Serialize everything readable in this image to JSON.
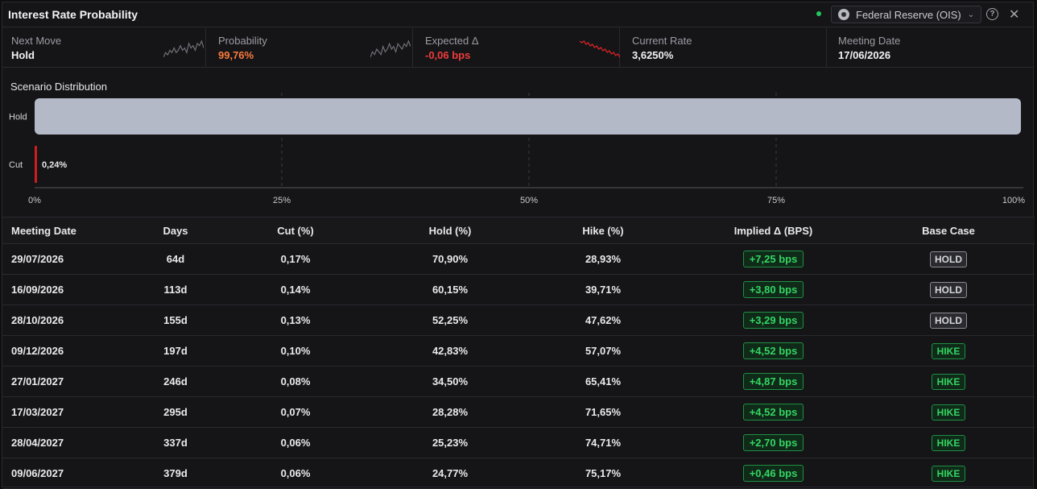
{
  "header": {
    "title": "Interest Rate Probability",
    "source": "Federal Reserve (OIS)",
    "help": "?",
    "close": "✕"
  },
  "stats": [
    {
      "label": "Next Move",
      "value": "Hold",
      "tone": "white",
      "spark": "gray",
      "spark_values": [
        3,
        5,
        4,
        6,
        5,
        7,
        5,
        6,
        8,
        6,
        7,
        5,
        9,
        7,
        8,
        6,
        9,
        8,
        10,
        7
      ]
    },
    {
      "label": "Probability",
      "value": "99,76%",
      "tone": "orange",
      "spark": "gray",
      "spark_values": [
        4,
        6,
        5,
        7,
        6,
        5,
        8,
        6,
        7,
        9,
        7,
        8,
        6,
        9,
        8,
        7,
        9,
        8,
        10,
        8
      ]
    },
    {
      "label": "Expected Δ",
      "value": "-0,06 bps",
      "tone": "red",
      "spark": "red",
      "spark_values": [
        10,
        9,
        10,
        8,
        9,
        7,
        8,
        6,
        7,
        5,
        6,
        4,
        5,
        3,
        4,
        2,
        3,
        1,
        2,
        0
      ]
    },
    {
      "label": "Current Rate",
      "value": "3,6250%",
      "tone": "white"
    },
    {
      "label": "Meeting Date",
      "value": "17/06/2026",
      "tone": "white"
    }
  ],
  "scenario": {
    "title": "Scenario Distribution",
    "bars": [
      {
        "name": "Hold",
        "value": 99.76,
        "label": ""
      },
      {
        "name": "Cut",
        "value": 0.24,
        "label": "0,24%"
      }
    ],
    "ticks": [
      "0%",
      "25%",
      "50%",
      "75%",
      "100%"
    ],
    "colors": {
      "hold": "#b4b9c8",
      "cut": "#d11f1f"
    }
  },
  "table": {
    "headers": [
      "Meeting Date",
      "Days",
      "Cut (%)",
      "Hold (%)",
      "Hike (%)",
      "Implied Δ (BPS)",
      "Base Case"
    ],
    "rows": [
      [
        "29/07/2026",
        "64d",
        "0,17%",
        "70,90%",
        "28,93%",
        "+7,25 bps",
        "HOLD"
      ],
      [
        "16/09/2026",
        "113d",
        "0,14%",
        "60,15%",
        "39,71%",
        "+3,80 bps",
        "HOLD"
      ],
      [
        "28/10/2026",
        "155d",
        "0,13%",
        "52,25%",
        "47,62%",
        "+3,29 bps",
        "HOLD"
      ],
      [
        "09/12/2026",
        "197d",
        "0,10%",
        "42,83%",
        "57,07%",
        "+4,52 bps",
        "HIKE"
      ],
      [
        "27/01/2027",
        "246d",
        "0,08%",
        "34,50%",
        "65,41%",
        "+4,87 bps",
        "HIKE"
      ],
      [
        "17/03/2027",
        "295d",
        "0,07%",
        "28,28%",
        "71,65%",
        "+4,52 bps",
        "HIKE"
      ],
      [
        "28/04/2027",
        "337d",
        "0,06%",
        "25,23%",
        "74,71%",
        "+2,70 bps",
        "HIKE"
      ],
      [
        "09/06/2027",
        "379d",
        "0,06%",
        "24,77%",
        "75,17%",
        "+0,46 bps",
        "HIKE"
      ]
    ]
  }
}
